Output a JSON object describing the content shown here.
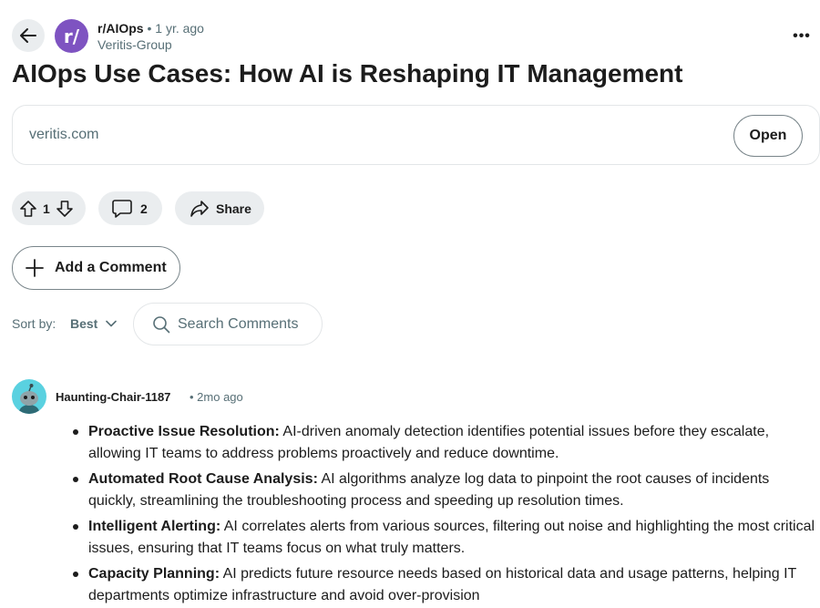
{
  "post": {
    "subreddit": "r/AIOps",
    "subreddit_icon_text": "r/",
    "separator": "•",
    "age": "1 yr. ago",
    "author": "Veritis-Group",
    "title": "AIOps Use Cases: How AI is Reshaping IT Management",
    "link_domain": "veritis.com",
    "open_label": "Open",
    "more_label": "•••"
  },
  "actions": {
    "vote_count": "1",
    "comment_count": "2",
    "share_label": "Share"
  },
  "comments_toolbar": {
    "add_comment_label": "Add a Comment",
    "sort_label": "Sort by:",
    "sort_value": "Best",
    "search_placeholder": "Search Comments"
  },
  "comment": {
    "author": "Haunting-Chair-1187",
    "age": "• 2mo ago",
    "items": [
      {
        "term": "Proactive Issue Resolution:",
        "text": " AI-driven anomaly detection identifies potential issues before they escalate, allowing IT teams to address problems proactively and reduce downtime."
      },
      {
        "term": "Automated Root Cause Analysis:",
        "text": " AI algorithms analyze log data to pinpoint the root causes of incidents quickly, streamlining the troubleshooting process and speeding up resolution times."
      },
      {
        "term": "Intelligent Alerting:",
        "text": " AI correlates alerts from various sources, filtering out noise and highlighting the most critical issues, ensuring that IT teams focus on what truly matters."
      },
      {
        "term": "Capacity Planning:",
        "text": " AI predicts future resource needs based on historical data and usage patterns, helping IT departments optimize infrastructure and avoid over-provision"
      }
    ]
  },
  "icons": {
    "back": "arrow-left-icon",
    "upvote": "arrow-up-icon",
    "downvote": "arrow-down-icon",
    "comment": "speech-bubble-icon",
    "share": "share-arrow-icon",
    "add": "plus-icon",
    "sort": "chevron-down-icon",
    "search": "search-icon"
  },
  "colors": {
    "subreddit_avatar": "#7e53c1",
    "pill_background": "#eaedef",
    "muted_text": "#576f76",
    "comment_avatar": "#5ad1e0"
  }
}
